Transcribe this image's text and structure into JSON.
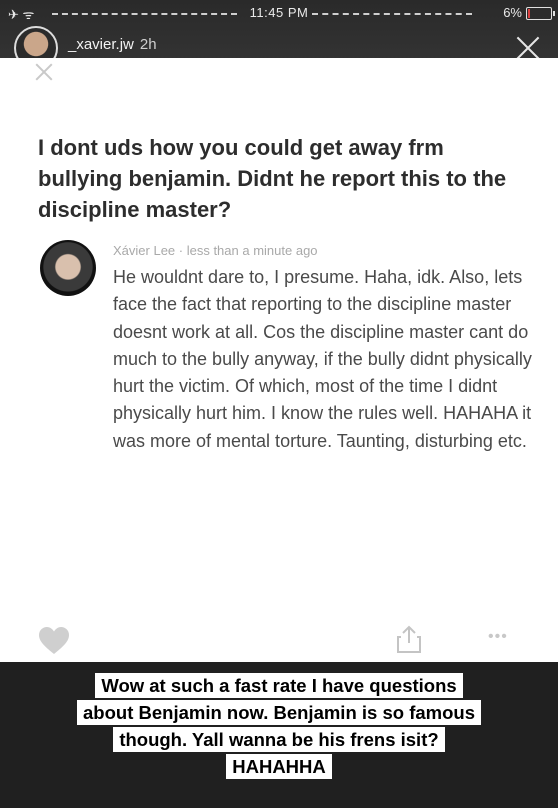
{
  "status_bar": {
    "time": "11:45 PM",
    "battery": "6%",
    "battery_level": 0.06
  },
  "story": {
    "username": "_xavier.jw",
    "posted": "2h"
  },
  "card": {
    "question": "I dont uds how you could get away frm bullying benjamin. Didnt he report this to the discipline master?",
    "answer_author": "Xávier Lee",
    "answer_time": "less than a minute ago",
    "answer_meta_sep": " · ",
    "answer_text": "He wouldnt dare to, I presume.  Haha, idk. Also, lets face the fact that reporting to the discipline master doesnt work at all. Cos the discipline master cant do much to the bully anyway, if the bully didnt physically hurt the victim. Of which, most of the time I didnt physically hurt him. I know the rules well. HAHAHA it was more of mental torture. Taunting, disturbing etc.",
    "icons": [
      "heart-icon",
      "share-icon",
      "more-icon"
    ]
  },
  "caption": {
    "lines": [
      "Wow at such a fast rate I have questions",
      "about Benjamin now. Benjamin is so famous",
      "though. Yall wanna be his frens isit?",
      "HAHAHHA"
    ]
  },
  "colors": {
    "card_bg": "#ffffff",
    "question_text": "#2d2d2d",
    "answer_text": "#4a4a4a",
    "meta_text": "#a9a9a9",
    "icon_gray": "#c8c8c8"
  }
}
